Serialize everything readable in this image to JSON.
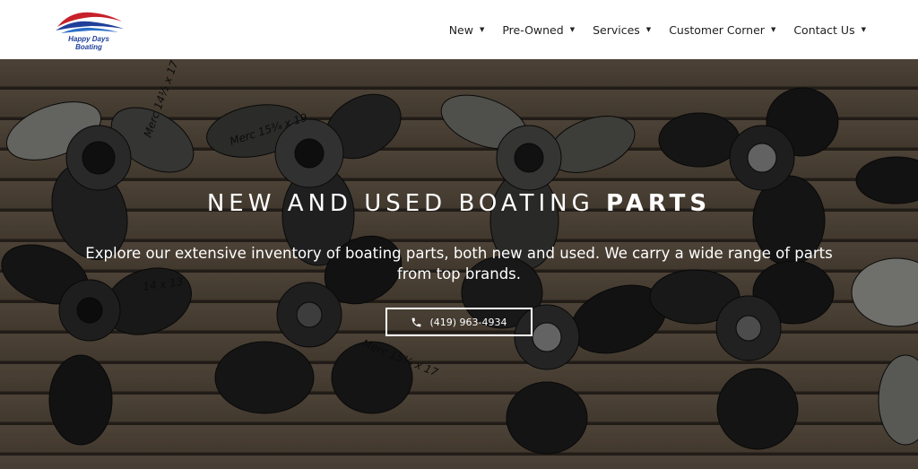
{
  "logo": {
    "line1": "Happy Days",
    "line2": "Boating"
  },
  "nav": [
    {
      "label": "New"
    },
    {
      "label": "Pre-Owned"
    },
    {
      "label": "Services"
    },
    {
      "label": "Customer Corner"
    },
    {
      "label": "Contact Us"
    }
  ],
  "hero": {
    "title_light": "NEW AND USED BOATING ",
    "title_bold": "PARTS",
    "subtitle": "Explore our extensive inventory of boating parts, both new and used. We carry a wide range of parts from top brands.",
    "phone": "(419) 963-4934",
    "prop_labels": [
      "Merc 15¾ x 19",
      "14 x 13",
      "Merc 15¾ x 17",
      "Merc 14½ x 17"
    ]
  },
  "colors": {
    "nav_text": "#222222",
    "logo_blue": "#1f3f9a",
    "logo_red": "#c8202a",
    "hero_text": "#ffffff"
  },
  "icons": {
    "phone": "phone-icon",
    "caret": "caret-down-icon"
  }
}
